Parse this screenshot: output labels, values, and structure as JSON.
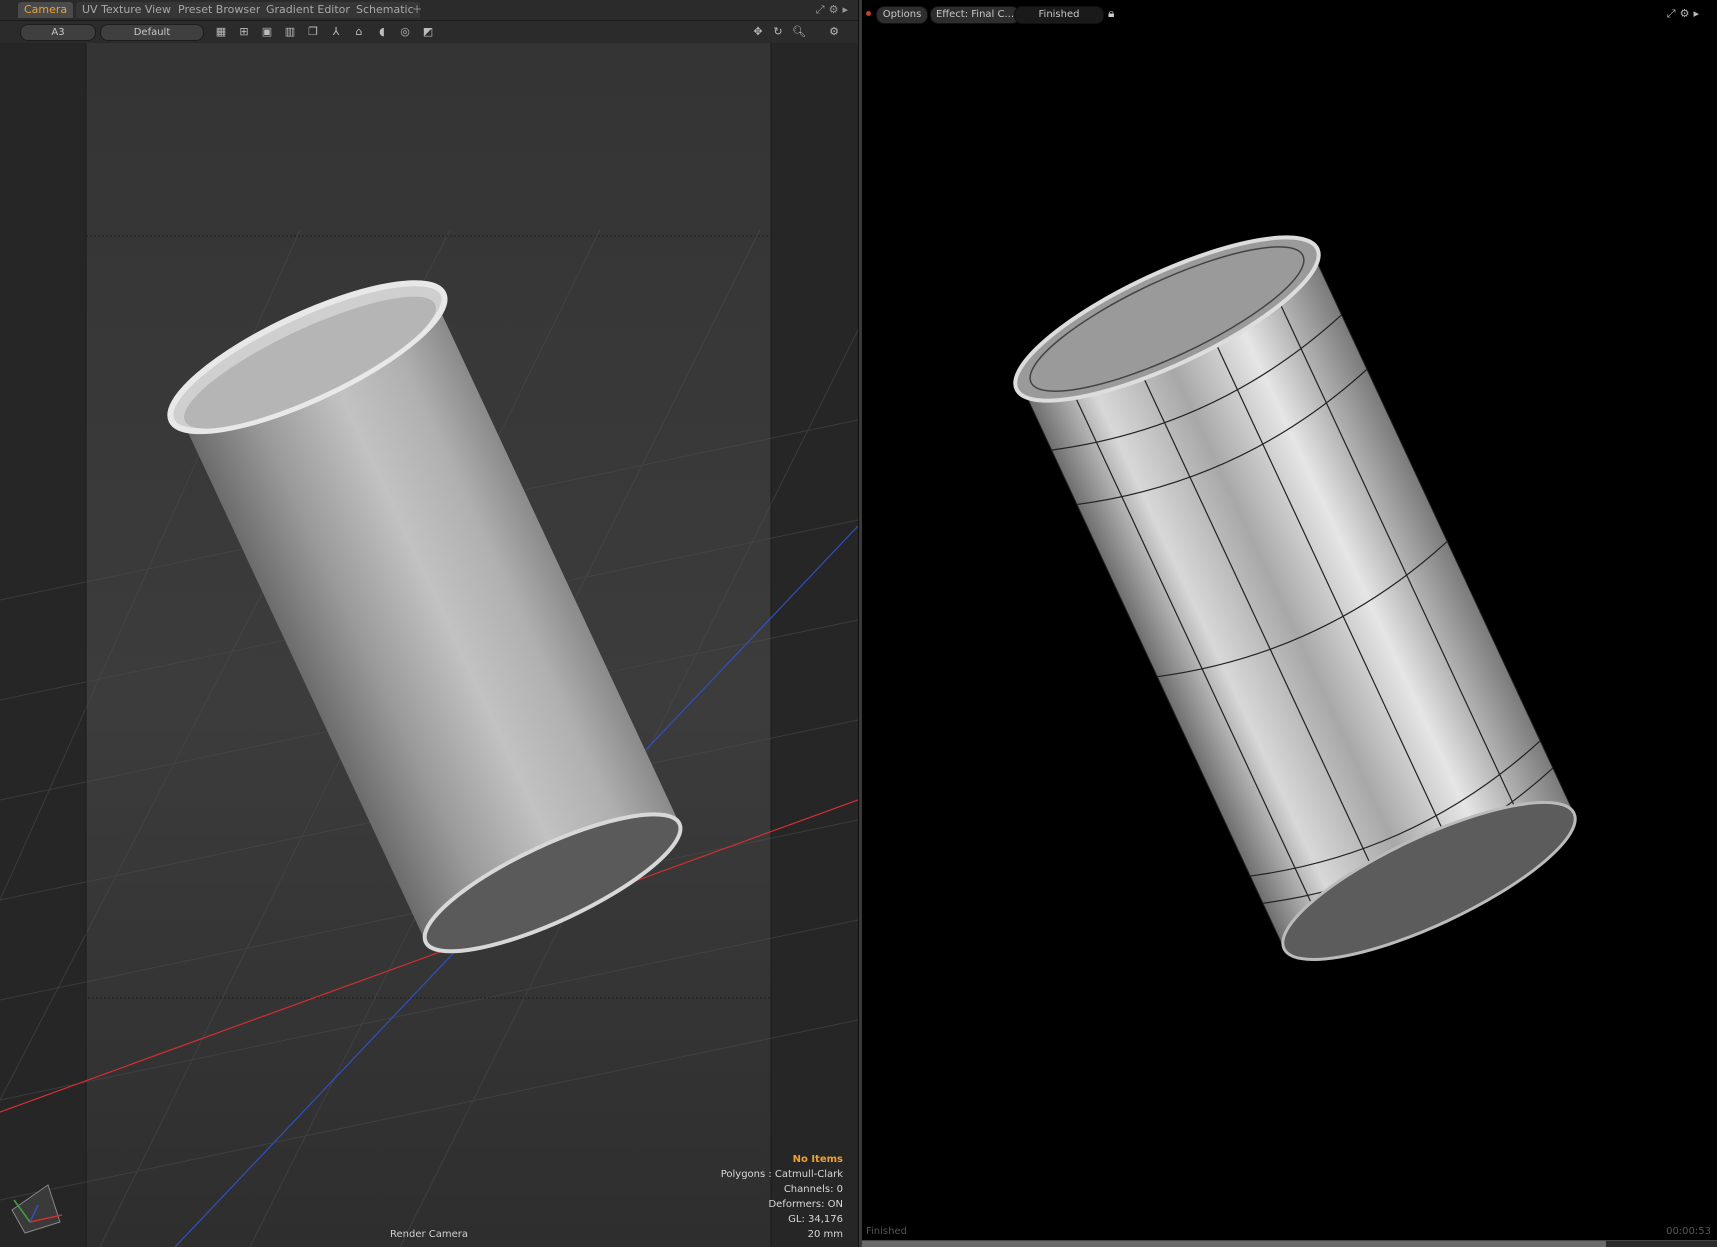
{
  "left_panel": {
    "tabs": [
      "Camera",
      "UV Texture View",
      "Preset Browser",
      "Gradient Editor",
      "Schematic"
    ],
    "add_tab": "+",
    "toolbar": {
      "view_preset": "A3",
      "shading_preset": "Default"
    },
    "hud": {
      "selection": "No Items",
      "polygons": "Polygons : Catmull-Clark",
      "channels": "Channels: 0",
      "deformers": "Deformers: ON",
      "gl": "GL: 34,176",
      "focal": "20 mm"
    },
    "camera_label": "Render Camera"
  },
  "right_panel": {
    "options_label": "Options",
    "effect_label": "Effect: Final C...",
    "status_pill": "Finished",
    "status_text": "Finished",
    "elapsed": "00:00:53",
    "progress_percent": 87
  },
  "colors": {
    "accent": "#f0a030",
    "x_axis": "#d03030",
    "z_axis": "#3050c0"
  },
  "icons": [
    "maximize-icon",
    "gear-icon",
    "arrow-right-icon",
    "move-icon",
    "rotate-icon",
    "zoom-icon",
    "lock-icon"
  ]
}
